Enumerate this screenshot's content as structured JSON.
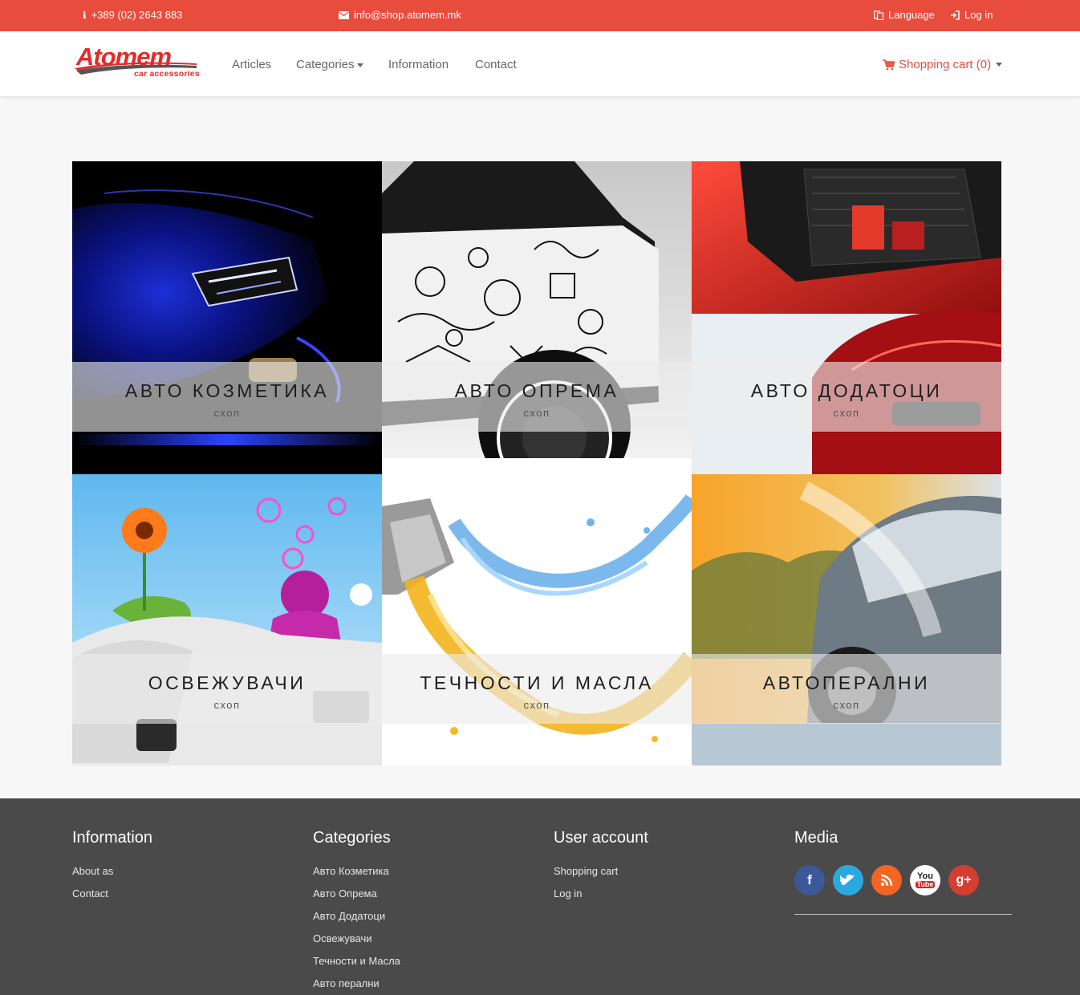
{
  "topbar": {
    "phone": "+389 (02) 2643 883",
    "email": "info@shop.atomem.mk",
    "language": "Language",
    "login": "Log in",
    "bg_color": "#e84c3d"
  },
  "header": {
    "logo_text": "Atomem",
    "logo_tagline": "car accessories",
    "nav": [
      {
        "label": "Articles"
      },
      {
        "label": "Categories",
        "has_dropdown": true
      },
      {
        "label": "Information"
      },
      {
        "label": "Contact"
      }
    ],
    "cart_label": "Shopping cart (0)"
  },
  "tiles": [
    {
      "title": "АВТО КОЗМЕТИКА",
      "subtitle": "схоп"
    },
    {
      "title": "АВТО ОПРЕМА",
      "subtitle": "схоп"
    },
    {
      "title": "АВТО ДОДАТОЦИ",
      "subtitle": "схоп"
    },
    {
      "title": "ОСВЕЖУВАЧИ",
      "subtitle": "схоп"
    },
    {
      "title": "ТЕЧНОСТИ И МАСЛА",
      "subtitle": "схоп"
    },
    {
      "title": "АВТОПЕРАЛНИ",
      "subtitle": "схоп"
    }
  ],
  "footer": {
    "information": {
      "heading": "Information",
      "links": [
        "About as",
        "Contact"
      ]
    },
    "categories": {
      "heading": "Categories",
      "links": [
        "Авто Козметика",
        "Авто Опрема",
        "Авто Додатоци",
        "Освежувачи",
        "Течности и Масла",
        "Авто перални"
      ]
    },
    "account": {
      "heading": "User account",
      "links": [
        "Shopping cart",
        "Log in"
      ]
    },
    "media": {
      "heading": "Media",
      "icons": [
        {
          "name": "facebook-icon",
          "glyph": "f",
          "color": "#3b5998"
        },
        {
          "name": "twitter-icon",
          "glyph": "t",
          "color": "#2aa9e0"
        },
        {
          "name": "rss-icon",
          "glyph": "r",
          "color": "#f26522"
        },
        {
          "name": "youtube-icon",
          "glyph": "You Tube",
          "color": "#ffffff"
        },
        {
          "name": "google-plus-icon",
          "glyph": "g+",
          "color": "#d23f31"
        }
      ]
    }
  }
}
